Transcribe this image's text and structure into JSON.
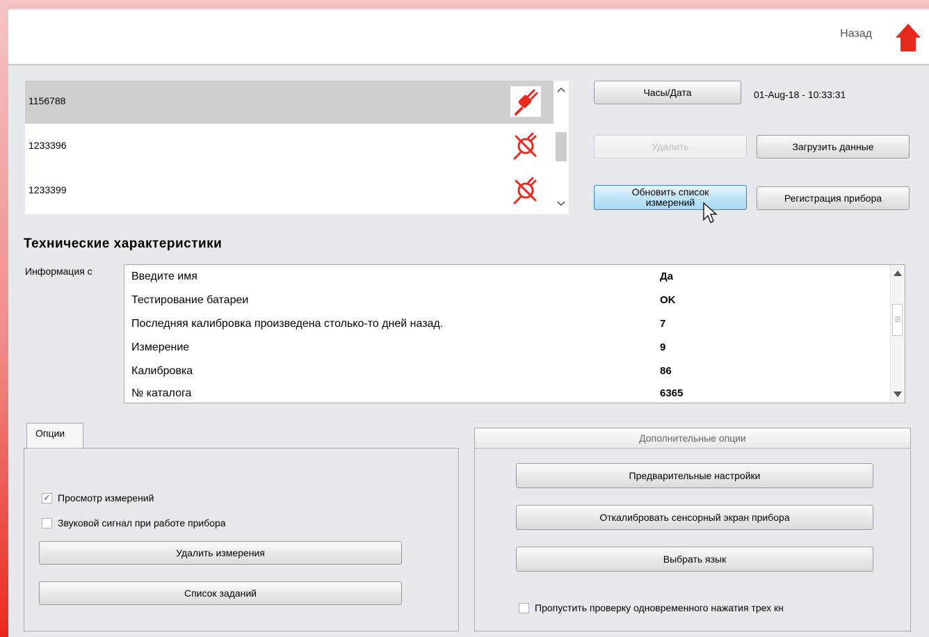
{
  "header": {
    "back_label": "Назад",
    "home_icon": "home-icon"
  },
  "devices": [
    {
      "id": "1156788",
      "status_icon": "plug-connected-icon",
      "selected": true
    },
    {
      "id": "1233396",
      "status_icon": "plug-disconnected-icon",
      "selected": false
    },
    {
      "id": "1233399",
      "status_icon": "plug-disconnected-icon",
      "selected": false
    }
  ],
  "buttons": {
    "clock": "Часы/Дата",
    "delete": "Удалить",
    "load_data": "Загрузить данные",
    "refresh_line1": "Обновить список",
    "refresh_line2": "измерений",
    "register": "Регистрация прибора"
  },
  "datetime": "01-Aug-18 - 10:33:31",
  "tech": {
    "title": "Технические характеристики",
    "info_label": "Информация с",
    "rows": [
      {
        "key": "Введите имя",
        "value": "Да"
      },
      {
        "key": "Тестирование батареи",
        "value": "OK"
      },
      {
        "key": "Последняя калибровка произведена столько-то дней назад.",
        "value": "7"
      },
      {
        "key": "Измерение",
        "value": "9"
      },
      {
        "key": "Калибровка",
        "value": "86"
      },
      {
        "key": "№ каталога",
        "value": "6365"
      }
    ]
  },
  "options": {
    "tab_label": "Опции",
    "view_measurements": "Просмотр измерений",
    "view_checked": true,
    "beep": "Звуковой сигнал при работе прибора",
    "beep_checked": false,
    "delete_measurements": "Удалить измерения",
    "task_list": "Список заданий"
  },
  "extra": {
    "title": "Дополнительные опции",
    "presets": "Предварительные настройки",
    "calibrate_touch": "Откалибровать сенсорный экран прибора",
    "choose_language": "Выбрать язык",
    "skip_check": "Пропустить проверку одновременного нажатия трех кн",
    "skip_checked": false
  },
  "colors": {
    "accent_red": "#e8291d",
    "hover_blue": "#bfe4f9"
  }
}
